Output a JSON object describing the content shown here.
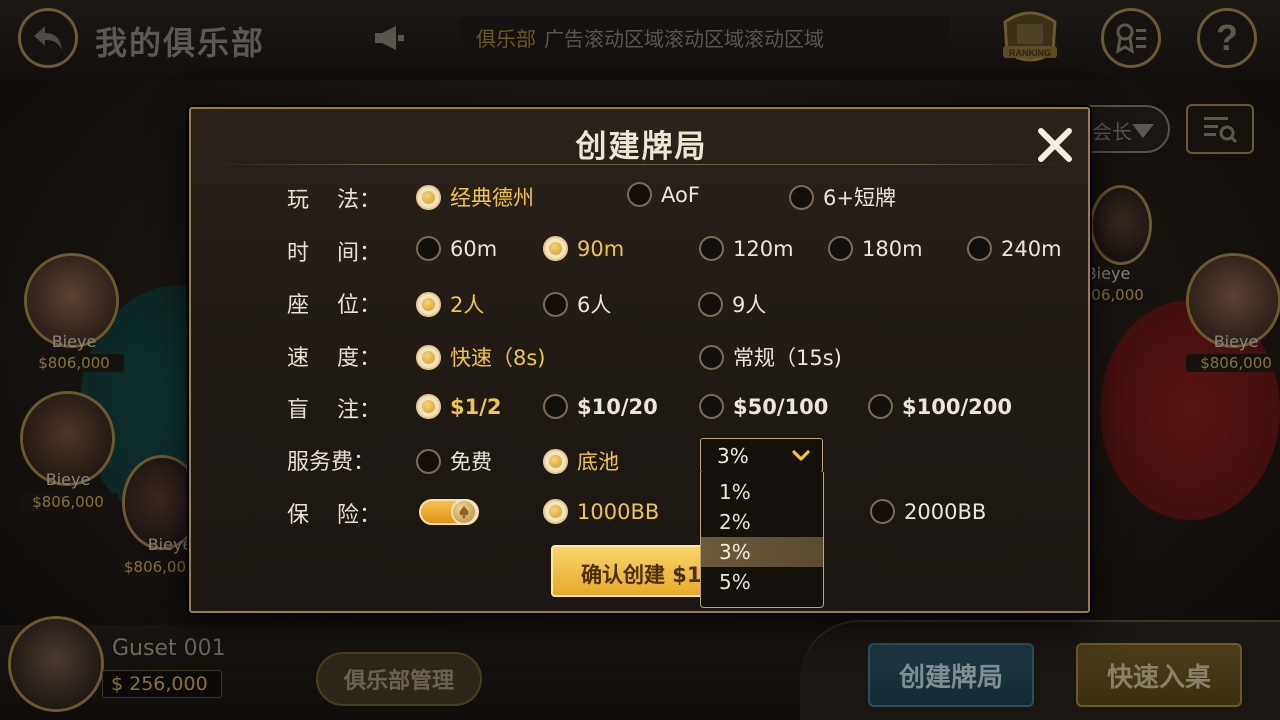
{
  "header": {
    "title": "我的俱乐部",
    "marquee_club": "俱乐部",
    "marquee_text": "广告滚动区域滚动区域滚动区域",
    "ranking_label": "RANKING"
  },
  "filter": {
    "label": "会长"
  },
  "players": [
    {
      "name": "Bieye",
      "chips": "$806,000"
    },
    {
      "name": "Bieye",
      "chips": "$806,000"
    },
    {
      "name": "Bieye",
      "chips": "$806,00"
    },
    {
      "name": "Bieye",
      "chips": "$806,000"
    },
    {
      "name": "Bieye",
      "chips": "$806,000"
    }
  ],
  "self": {
    "name": "Guset 001",
    "chips": "$ 256,000"
  },
  "bottom": {
    "club_mgmt": "俱乐部管理",
    "create_table": "创建牌局",
    "quick_join": "快速入桌"
  },
  "modal": {
    "title": "创建牌局",
    "rows": {
      "mode": {
        "label": "玩    法：",
        "options": [
          "经典德州",
          "AoF",
          "6+短牌"
        ],
        "selected": 0
      },
      "time": {
        "label": "时    间：",
        "options": [
          "60m",
          "90m",
          "120m",
          "180m",
          "240m"
        ],
        "selected": 1
      },
      "seats": {
        "label": "座    位：",
        "options": [
          "2人",
          "6人",
          "9人"
        ],
        "selected": 0
      },
      "speed": {
        "label": "速    度：",
        "options": [
          "快速（8s)",
          "常规（15s)"
        ],
        "selected": 0
      },
      "blinds": {
        "label": "盲    注：",
        "options": [
          "$1/2",
          "$10/20",
          "$50/100",
          "$100/200"
        ],
        "selected": 0
      },
      "fee": {
        "label": "服务费：",
        "options": [
          "免费",
          "底池"
        ],
        "selected": 1
      },
      "insurance": {
        "label": "保    险：",
        "options": [
          "1000BB",
          "2000BB"
        ],
        "selected": 0,
        "toggle_on": true
      }
    },
    "fee_select": {
      "value": "3%",
      "options": [
        "1%",
        "2%",
        "3%",
        "5%"
      ],
      "highlighted": 2
    },
    "confirm": "确认创建 $10"
  }
}
